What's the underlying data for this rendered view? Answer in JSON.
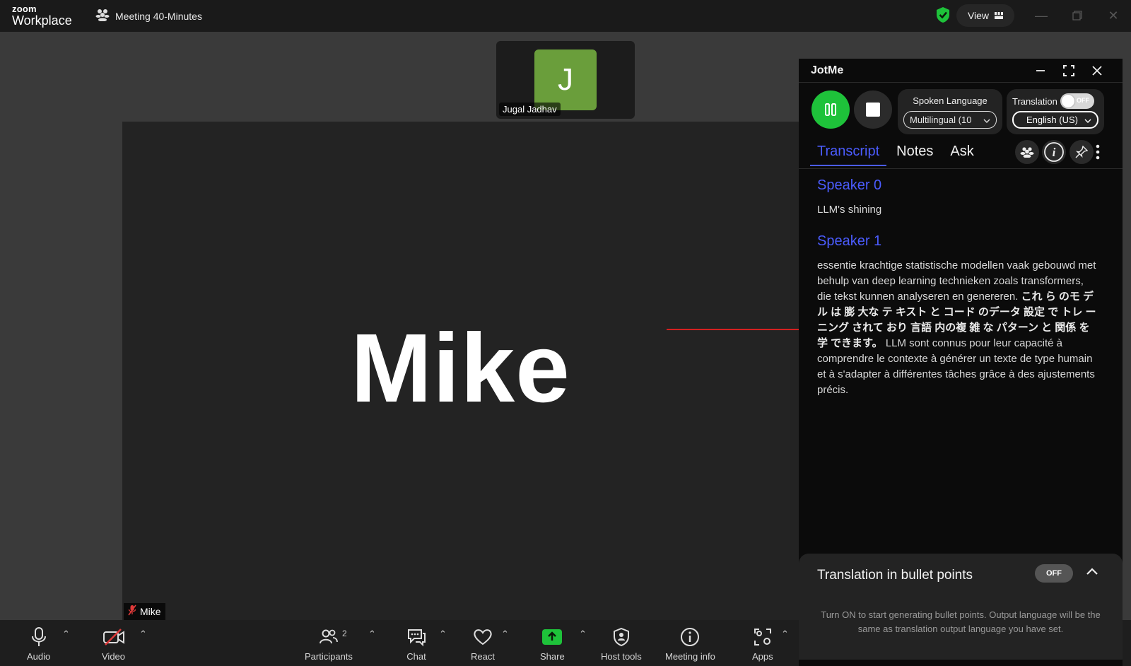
{
  "app": {
    "brand_top": "zoom",
    "brand_bottom": "Workplace",
    "meeting_title": "Meeting 40-Minutes",
    "view_label": "View"
  },
  "thumbnail": {
    "initial": "J",
    "name": "Jugal Jadhav",
    "avatar_color": "#6a9e3b"
  },
  "main_video": {
    "display_name": "Mike",
    "name_tag": "Mike"
  },
  "toolbar": {
    "audio": "Audio",
    "video": "Video",
    "participants": "Participants",
    "participants_count": "2",
    "chat": "Chat",
    "react": "React",
    "share": "Share",
    "host_tools": "Host tools",
    "meeting_info": "Meeting info",
    "apps": "Apps"
  },
  "jotme": {
    "title": "JotMe",
    "spoken_language_label": "Spoken Language",
    "spoken_language_value": "Multilingual (10",
    "translation_label": "Translation",
    "translation_toggle": "OFF",
    "translation_value": "English (US)",
    "tabs": [
      {
        "label": "Transcript",
        "active": true
      },
      {
        "label": "Notes",
        "active": false
      },
      {
        "label": "Ask",
        "active": false
      }
    ],
    "transcript": [
      {
        "speaker": "Speaker 0",
        "text": "LLM's shining"
      },
      {
        "speaker": "Speaker 1",
        "text": "essentie krachtige statistische modellen vaak gebouwd met behulp van deep learning technieken zoals transformers, die tekst kunnen analyseren en genereren.",
        "bold": "これ ら のモ デル は 膨 大な テ キスト と コード のデータ 設定 で トレ ーニング されて おり 言語 内の複 雑 な パターン と 関係 を 学 できます。",
        "tail": " LLM sont connus pour leur capacité à comprendre le contexte à générer un texte de type humain et à s'adapter à différentes tâches grâce à des ajustements précis."
      }
    ],
    "bullets": {
      "title": "Translation in bullet points",
      "toggle": "OFF",
      "description": "Turn ON to start generating bullet points. Output language will be the same as translation output language you have set."
    },
    "accent_color": "#4b5cff",
    "record_color": "#1ec23a"
  }
}
